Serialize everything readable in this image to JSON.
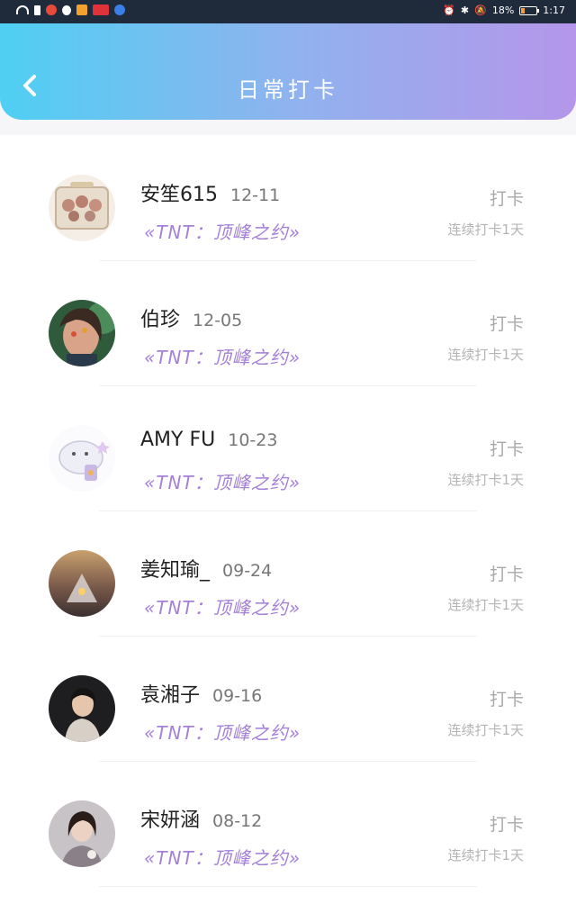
{
  "status_bar": {
    "battery": "18%",
    "time": "1:17"
  },
  "header": {
    "title": "日常打卡"
  },
  "rows": [
    {
      "name": "安笙615",
      "date": "12-11",
      "group": "«TNT：顶峰之约»",
      "action": "打卡",
      "streak": "连续打卡1天"
    },
    {
      "name": "伯珍",
      "date": "12-05",
      "group": "«TNT：顶峰之约»",
      "action": "打卡",
      "streak": "连续打卡1天"
    },
    {
      "name": "AMY FU",
      "date": "10-23",
      "group": "«TNT：顶峰之约»",
      "action": "打卡",
      "streak": "连续打卡1天"
    },
    {
      "name": "姜知瑜_",
      "date": "09-24",
      "group": "«TNT：顶峰之约»",
      "action": "打卡",
      "streak": "连续打卡1天"
    },
    {
      "name": "袁湘子",
      "date": "09-16",
      "group": "«TNT：顶峰之约»",
      "action": "打卡",
      "streak": "连续打卡1天"
    },
    {
      "name": "宋妍涵",
      "date": "08-12",
      "group": "«TNT：顶峰之约»",
      "action": "打卡",
      "streak": "连续打卡1天"
    }
  ]
}
